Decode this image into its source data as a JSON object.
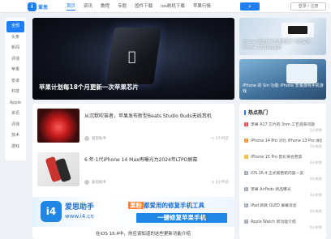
{
  "header": {
    "logo_glyph": "i",
    "logo_text": "爱思",
    "nav": [
      "首页",
      "资讯",
      "教程",
      "专题",
      "固件下载",
      "ios刷机下载",
      "苹果行情"
    ],
    "search_glyph": "⌕",
    "login_text": "登录 / 注册"
  },
  "leftnav": [
    "全部",
    "头条",
    "新闻",
    "评测",
    "苹果",
    "安卓",
    "科技",
    "Apple",
    "资讯",
    "评测",
    "技术",
    "游戏"
  ],
  "hero": {
    "title": "苹果计划每18个月更新一次苹果芯片"
  },
  "side_cards": [
    {
      "caption": "iPhone 新款SIM卡槽改变了 可能是为iPhone 15/16准备的"
    },
    {
      "caption": "iPhone 的 Siri 功能 iPhone 安装游戏手机游戏"
    }
  ],
  "hot": {
    "title": "热点热门",
    "items": [
      {
        "rank": "1",
        "text": "苹果 A17 芯片的 3nm 工艺良率问题",
        "time": "1小时前"
      },
      {
        "rank": "2",
        "text": "iPhone 14 Pro 对比 iPhone 13 Pro 体验",
        "time": "1小时前"
      },
      {
        "rank": "3",
        "text": "iPhone 15 Pro 售价将会更高",
        "time": "2小时前"
      },
      {
        "rank": "4",
        "text": "iOS 16.4 正式版更新内容一览",
        "time": "3小时前"
      },
      {
        "rank": "5",
        "text": "苹果 AirPods 新品曝光",
        "time": "3小时前"
      },
      {
        "rank": "6",
        "text": "iPad 新款 OLED 屏幕消息",
        "time": "4小时前"
      },
      {
        "rank": "7",
        "text": "Apple Watch 新功能介绍",
        "time": "5小时前"
      }
    ]
  },
  "posts": [
    {
      "title": "从沉默吹笛者，苹果发布新型Beats Studio Buds无线耳机",
      "author": "爱思助手",
      "stats": "◷ 1小时前"
    },
    {
      "title": "6 年·1代iPhone 14 Max再曝光为2024年LTPO屏幕",
      "author": "爱思助手",
      "stats": "◷ 2小时前"
    }
  ],
  "ad": {
    "mark": "i4",
    "brand": "爱思助手",
    "url": "www.i4.cn",
    "slogan_badge": "果粉",
    "slogan_rest": "都爱用的修复手机工具",
    "slogan2": "一键修复苹果手机"
  },
  "bottom_line": "在iOS 16.4中，你应该知道的这些更新功能介绍"
}
